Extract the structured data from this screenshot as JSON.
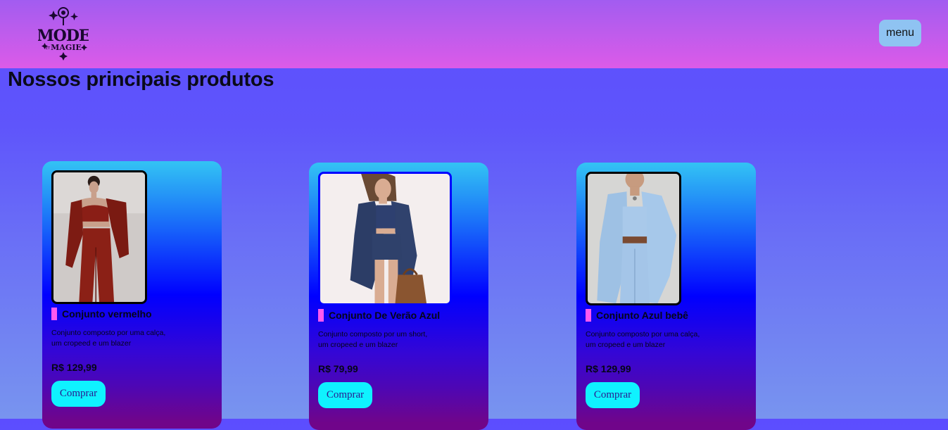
{
  "header": {
    "logo_text": "MODE ET MAGIE",
    "menu_label": "menu"
  },
  "main": {
    "title": "Nossos principais produtos",
    "products": [
      {
        "name": "Conjunto vermelho",
        "description_lines": [
          "Conjunto composto por uma calça,",
          "um cropeed e um blazer"
        ],
        "price": "R$ 129,99",
        "buy_label": "Comprar",
        "image": "red-outfit-photo"
      },
      {
        "name": "Conjunto De Verão Azul",
        "description_lines": [
          "Conjunto composto por um short,",
          "um cropeed e um blazer"
        ],
        "price": "R$ 79,99",
        "buy_label": "Comprar",
        "image": "navy-summer-outfit-photo"
      },
      {
        "name": "Conjunto Azul bebê",
        "description_lines": [
          "Conjunto composto por uma calça,",
          "um cropeed e um blazer"
        ],
        "price": "R$ 129,99",
        "buy_label": "Comprar",
        "image": "baby-blue-outfit-photo"
      }
    ]
  },
  "colors": {
    "header_gradient": [
      "#a25cf0",
      "#dc5be8"
    ],
    "menu_button": "#8fc3f2",
    "buy_button": "#0ff2ff",
    "name_accent": "#ff59f0"
  }
}
